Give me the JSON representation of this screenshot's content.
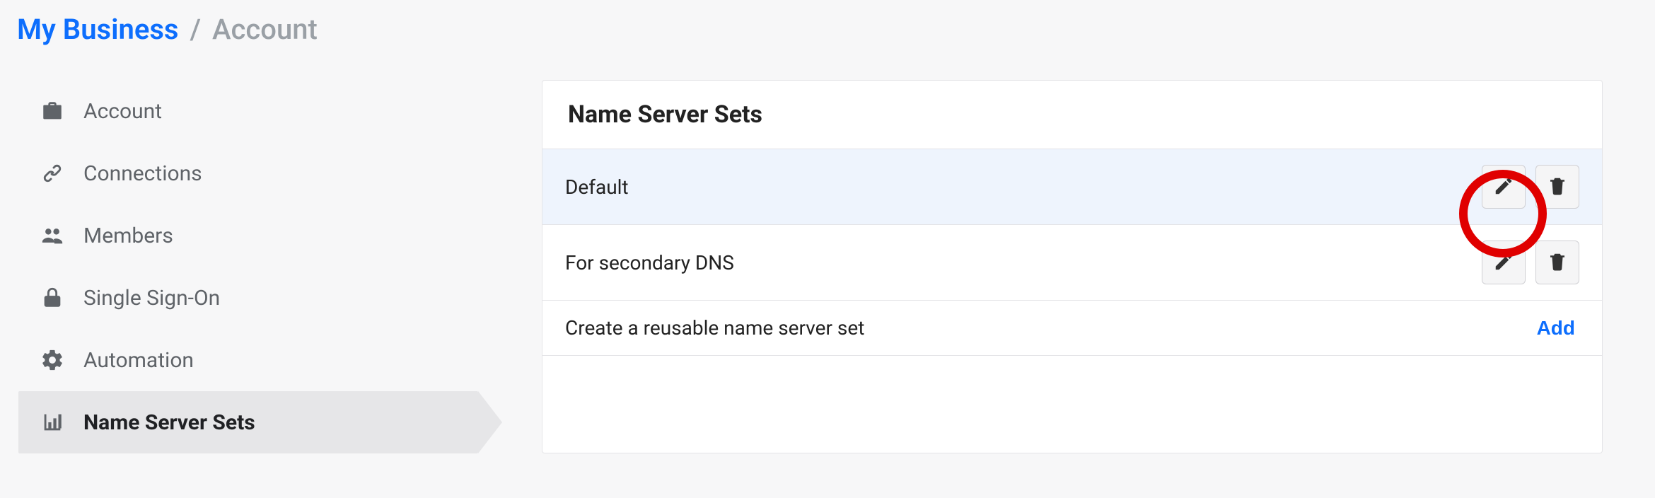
{
  "breadcrumb": {
    "primary": "My Business",
    "separator": "/",
    "secondary": "Account"
  },
  "sidebar": {
    "items": [
      {
        "label": "Account",
        "icon": "briefcase-icon"
      },
      {
        "label": "Connections",
        "icon": "link-icon"
      },
      {
        "label": "Members",
        "icon": "people-icon"
      },
      {
        "label": "Single Sign-On",
        "icon": "lock-icon"
      },
      {
        "label": "Automation",
        "icon": "gear-icon"
      },
      {
        "label": "Name Server Sets",
        "icon": "chart-icon"
      }
    ],
    "active_index": 5
  },
  "panel": {
    "title": "Name Server Sets",
    "sets": [
      {
        "name": "Default",
        "highlight": true
      },
      {
        "name": "For secondary DNS",
        "highlight": false
      }
    ],
    "create_text": "Create a reusable name server set",
    "add_label": "Add"
  },
  "annotation": {
    "circled_button": "edit-button-0"
  }
}
